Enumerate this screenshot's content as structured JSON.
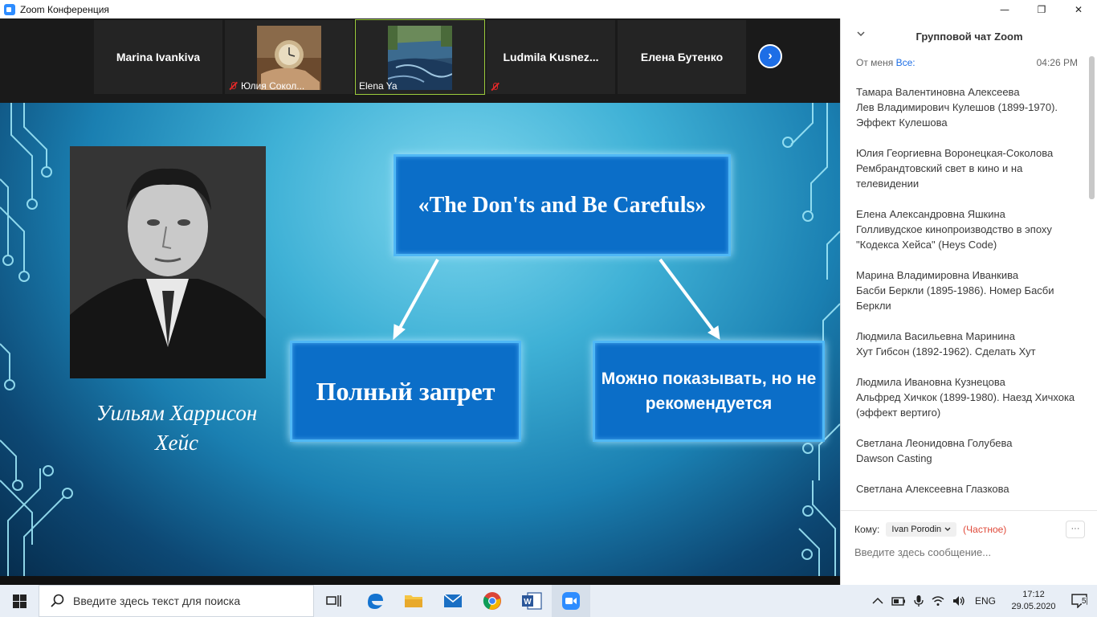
{
  "window": {
    "title": "Zoom Конференция",
    "minimize": "—",
    "maximize": "❐",
    "close": "✕"
  },
  "participants": [
    {
      "name": "Marina Ivankiva"
    },
    {
      "name": "Юлия Сокол..."
    },
    {
      "name": "Elena Ya"
    },
    {
      "name": "Ludmila  Kusnez..."
    },
    {
      "name": "Елена Бутенко"
    }
  ],
  "slide": {
    "person_name_line1": "Уильям Харрисон",
    "person_name_line2": "Хейс",
    "top_box": "«The Don'ts and Be Carefuls»",
    "left_box": "Полный запрет",
    "right_box": "Можно показывать, но не рекомендуется"
  },
  "chat": {
    "title": "Групповой чат Zoom",
    "from_label": "От меня",
    "to_label": "Все:",
    "time": "04:26 PM",
    "messages": [
      {
        "author": "Тамара Валентиновна Алексеева",
        "text": "Лев Владимирович Кулешов (1899-1970). Эффект Кулешова"
      },
      {
        "author": "Юлия Георгиевна Воронецкая-Соколова",
        "text": "Рембрандтовский свет в кино и на телевидении"
      },
      {
        "author": "Елена Александровна Яшкина",
        "text": "Голливудское кинопроизводство в эпоху \"Кодекса Хейса\" (Heys  Code)"
      },
      {
        "author": "Марина Владимировна Иванкива",
        "text": "Басби Беркли (1895-1986). Номер Басби Беркли"
      },
      {
        "author": "Людмила Васильевна Маринина",
        "text": "Хут Гибсон (1892-1962). Сделать Хут"
      },
      {
        "author": "Людмила Ивановна Кузнецова",
        "text": "Альфред Хичкок (1899-1980). Наезд Хичхока (эффект вертиго)"
      },
      {
        "author": "Светлана Леонидовна Голубева",
        "text": "Dawson Casting"
      },
      {
        "author": "Светлана Алексеевна Глазкова",
        "text": ""
      }
    ],
    "to_prefix": "Кому:",
    "recipient": "Ivan Porodin",
    "private_label": "(Частное)",
    "more": "···",
    "input_placeholder": "Введите здесь сообщение..."
  },
  "taskbar": {
    "search_placeholder": "Введите здесь текст для поиска",
    "language": "ENG",
    "time": "17:12",
    "date": "29.05.2020",
    "notifications": "5"
  }
}
